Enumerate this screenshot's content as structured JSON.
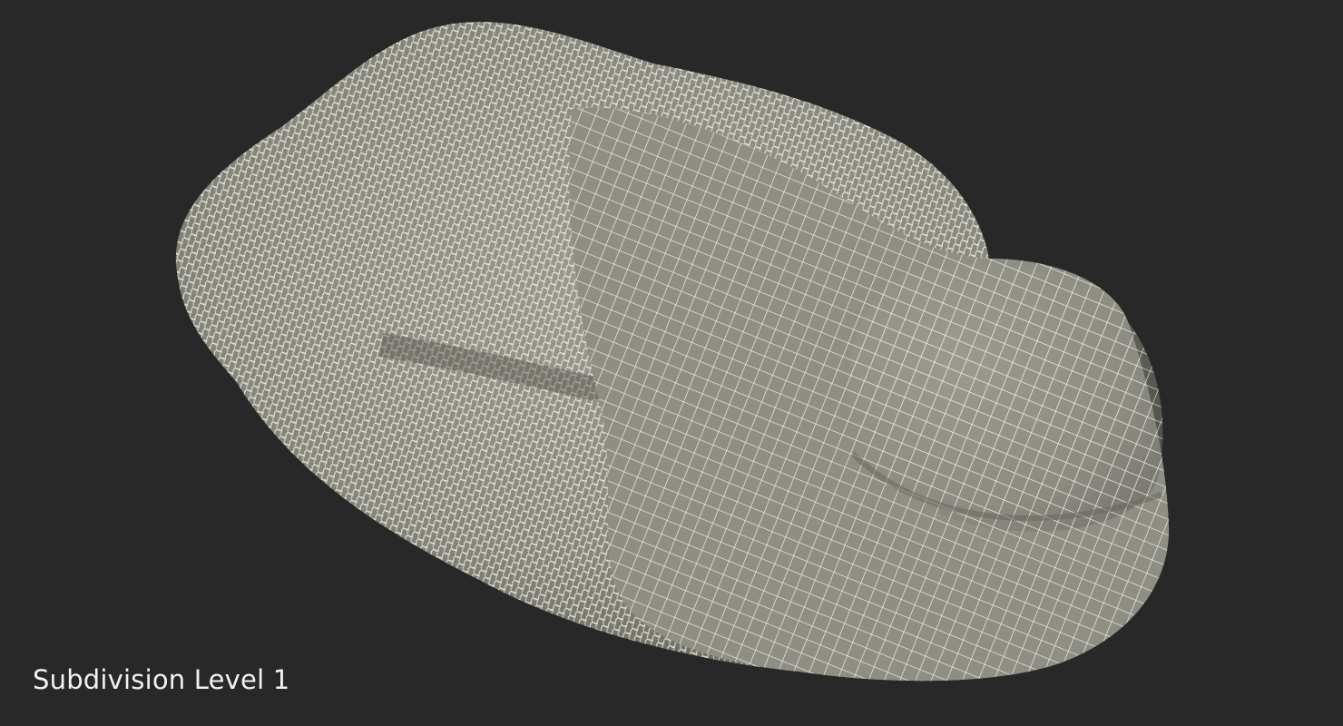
{
  "caption": {
    "text": "Subdivision Level 1"
  },
  "colors": {
    "background": "#282828",
    "surface": "#8a8a80",
    "surface_shadow": "#5f5f57",
    "wireframe": "#f4f3ea"
  }
}
